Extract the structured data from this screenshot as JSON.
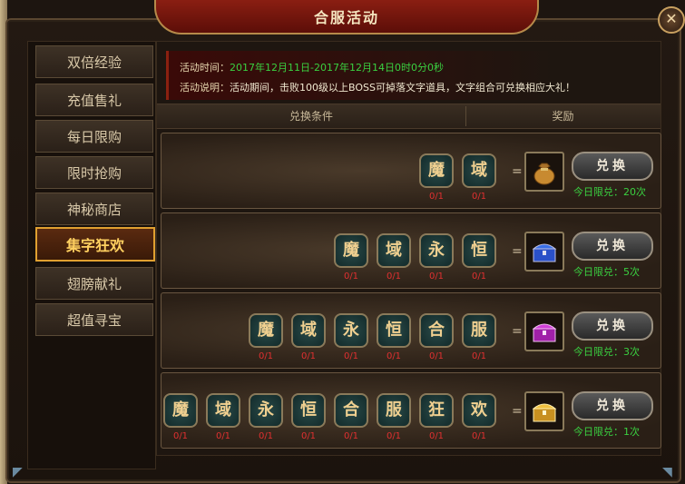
{
  "window": {
    "title": "合服活动",
    "close_glyph": "✕"
  },
  "sidebar": {
    "tabs": [
      {
        "label": "双倍经验",
        "active": false
      },
      {
        "label": "充值售礼",
        "active": false
      },
      {
        "label": "每日限购",
        "active": false
      },
      {
        "label": "限时抢购",
        "active": false
      },
      {
        "label": "神秘商店",
        "active": false
      },
      {
        "label": "集字狂欢",
        "active": true
      },
      {
        "label": "翅膀献礼",
        "active": false
      },
      {
        "label": "超值寻宝",
        "active": false
      }
    ]
  },
  "info": {
    "time_label": "活动时间：",
    "time_value": "2017年12月11日-2017年12月14日0时0分0秒",
    "desc_label": "活动说明：",
    "desc_value": "活动期间，击败100级以上BOSS可掉落文字道具，文字组合可兑换相应大礼！"
  },
  "table": {
    "header_condition": "兑换条件",
    "header_reward": "奖励",
    "equals": "=",
    "rows": [
      {
        "chars": [
          "魔",
          "域"
        ],
        "counts": [
          "0/1",
          "0/1"
        ],
        "reward_icon": "money-bag-icon",
        "button": "兑换",
        "limit": "今日限兑：20次"
      },
      {
        "chars": [
          "魔",
          "域",
          "永",
          "恒"
        ],
        "counts": [
          "0/1",
          "0/1",
          "0/1",
          "0/1"
        ],
        "reward_icon": "blue-chest-icon",
        "button": "兑换",
        "limit": "今日限兑：5次"
      },
      {
        "chars": [
          "魔",
          "域",
          "永",
          "恒",
          "合",
          "服"
        ],
        "counts": [
          "0/1",
          "0/1",
          "0/1",
          "0/1",
          "0/1",
          "0/1"
        ],
        "reward_icon": "purple-chest-icon",
        "button": "兑换",
        "limit": "今日限兑：3次"
      },
      {
        "chars": [
          "魔",
          "域",
          "永",
          "恒",
          "合",
          "服",
          "狂",
          "欢"
        ],
        "counts": [
          "0/1",
          "0/1",
          "0/1",
          "0/1",
          "0/1",
          "0/1",
          "0/1",
          "0/1"
        ],
        "reward_icon": "gold-chest-icon",
        "button": "兑换",
        "limit": "今日限兑：1次"
      }
    ]
  },
  "colors": {
    "accent_gold": "#e0a030",
    "limit_green": "#3ad040",
    "count_red": "#e03030",
    "title_red": "#8a1e12"
  }
}
